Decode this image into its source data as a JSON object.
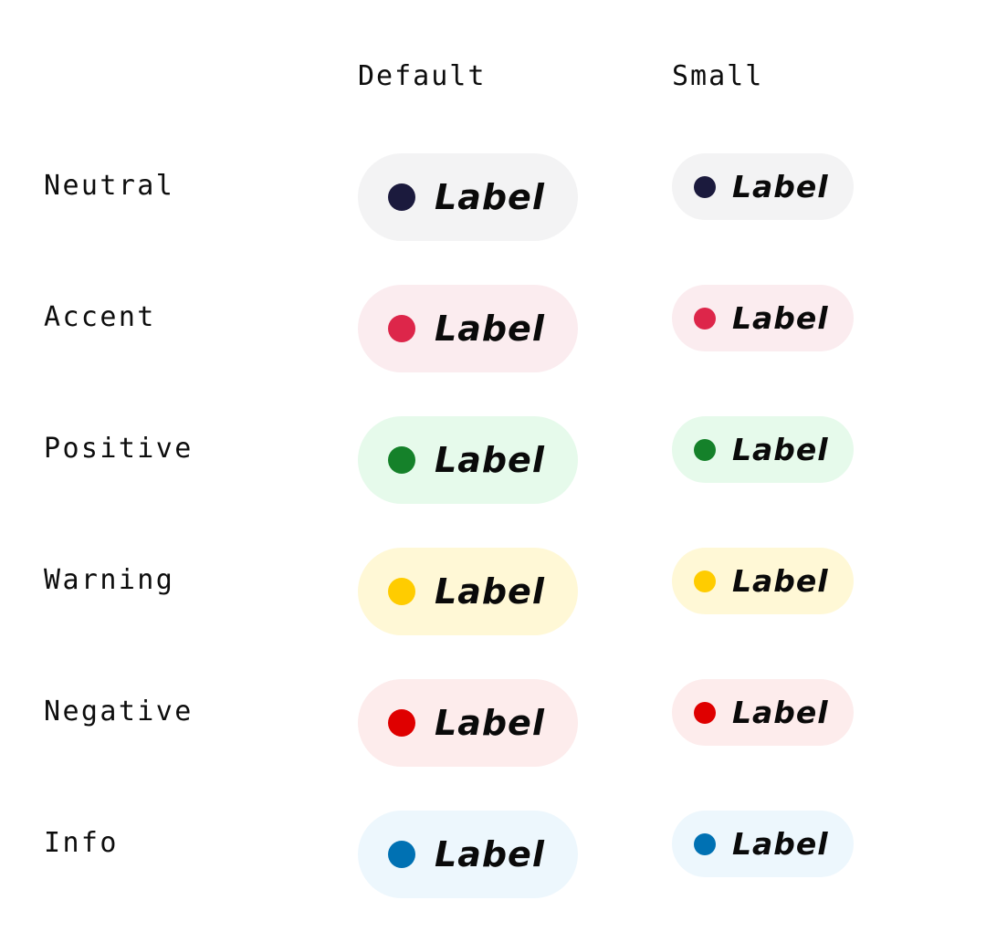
{
  "headers": {
    "default": "Default",
    "small": "Small"
  },
  "rows": [
    {
      "label": "Neutral",
      "badge_text": "Label",
      "dot_color": "#1b1a3d",
      "bg_color": "#f3f3f4"
    },
    {
      "label": "Accent",
      "badge_text": "Label",
      "dot_color": "#dd264a",
      "bg_color": "#fbecef"
    },
    {
      "label": "Positive",
      "badge_text": "Label",
      "dot_color": "#15812a",
      "bg_color": "#e6faeb"
    },
    {
      "label": "Warning",
      "badge_text": "Label",
      "dot_color": "#ffcc00",
      "bg_color": "#fff8d6"
    },
    {
      "label": "Negative",
      "badge_text": "Label",
      "dot_color": "#df0000",
      "bg_color": "#fdecec"
    },
    {
      "label": "Info",
      "badge_text": "Label",
      "dot_color": "#0071b3",
      "bg_color": "#edf7fd"
    }
  ]
}
